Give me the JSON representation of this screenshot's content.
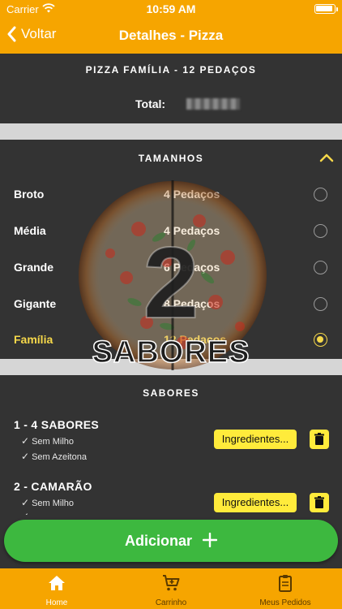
{
  "status_bar": {
    "carrier": "Carrier",
    "time": "10:59 AM"
  },
  "nav": {
    "back_label": "Voltar",
    "title": "Detalhes - Pizza"
  },
  "order": {
    "product_name": "PIZZA FAMÍLIA - 12 PEDAÇOS",
    "total_label": "Total:"
  },
  "sizes": {
    "title": "TAMANHOS",
    "items": [
      {
        "name": "Broto",
        "qty": "4 Pedaços",
        "selected": false
      },
      {
        "name": "Média",
        "qty": "4 Pedaços",
        "selected": false
      },
      {
        "name": "Grande",
        "qty": "6 Pedaços",
        "selected": false
      },
      {
        "name": "Gigante",
        "qty": "8 Pedaços",
        "selected": false
      },
      {
        "name": "Família",
        "qty": "12 Pedaços",
        "selected": true
      }
    ]
  },
  "overlay": {
    "number": "2",
    "label": "SABORES"
  },
  "flavors": {
    "title": "SABORES",
    "ingredients_label": "Ingredientes...",
    "items": [
      {
        "title": "1 - 4 SABORES",
        "notes": [
          "Sem Milho",
          "Sem Azeitona"
        ]
      },
      {
        "title": "2 - CAMARÃO",
        "notes": [
          "Sem Milho"
        ]
      }
    ]
  },
  "add_button": {
    "label": "Adicionar"
  },
  "tabs": [
    {
      "label": "Home",
      "icon": "home-icon",
      "active": true
    },
    {
      "label": "Carrinho",
      "icon": "cart-icon",
      "active": false
    },
    {
      "label": "Meus Pedidos",
      "icon": "clipboard-icon",
      "active": false
    }
  ],
  "colors": {
    "accent": "#F6A500",
    "highlight": "#F6D84A",
    "button_yellow": "#FFEB3B",
    "add_green": "#3DB83F",
    "panel": "#333333"
  }
}
